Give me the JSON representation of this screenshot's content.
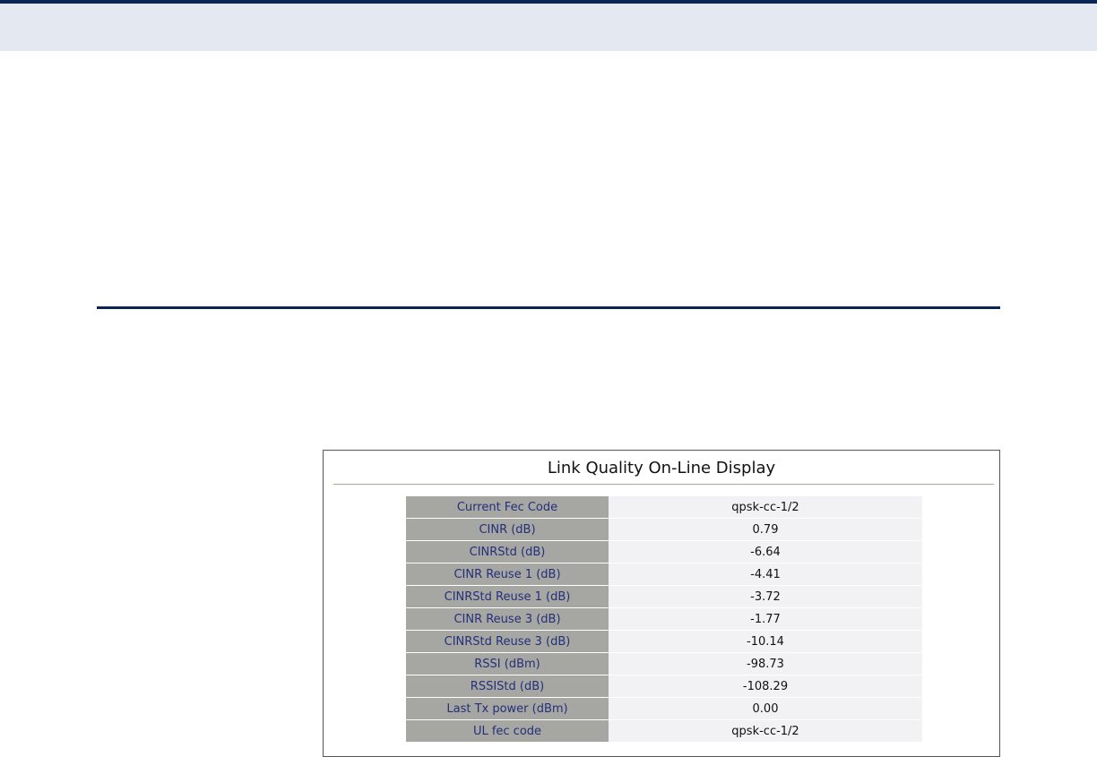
{
  "panel": {
    "title": "Link Quality On-Line Display",
    "rows": [
      {
        "label": "Current Fec Code",
        "value": "qpsk-cc-1/2"
      },
      {
        "label": "CINR (dB)",
        "value": "0.79"
      },
      {
        "label": "CINRStd (dB)",
        "value": "-6.64"
      },
      {
        "label": "CINR Reuse 1 (dB)",
        "value": "-4.41"
      },
      {
        "label": "CINRStd Reuse 1 (dB)",
        "value": "-3.72"
      },
      {
        "label": "CINR Reuse 3 (dB)",
        "value": "-1.77"
      },
      {
        "label": "CINRStd Reuse 3 (dB)",
        "value": "-10.14"
      },
      {
        "label": "RSSI (dBm)",
        "value": "-98.73"
      },
      {
        "label": "RSSIStd (dB)",
        "value": "-108.29"
      },
      {
        "label": "Last Tx power (dBm)",
        "value": "0.00"
      },
      {
        "label": "UL fec code",
        "value": "qpsk-cc-1/2"
      }
    ]
  }
}
